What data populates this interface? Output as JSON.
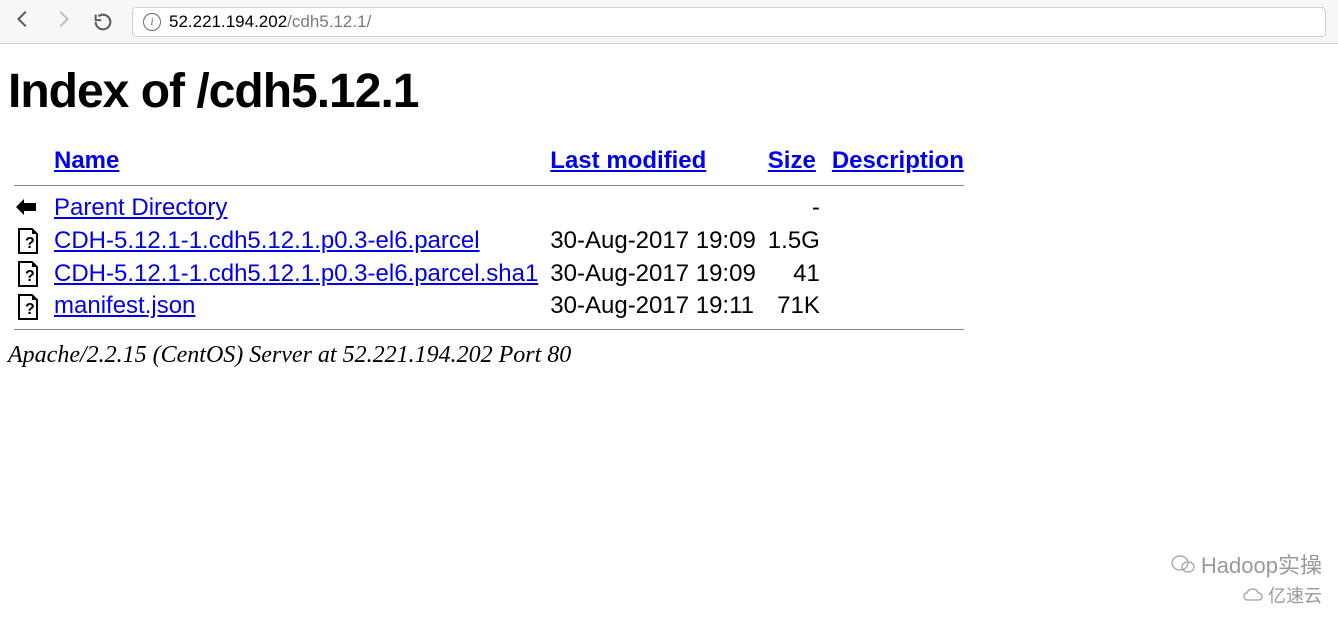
{
  "browser": {
    "url_host": "52.221.194.202",
    "url_path": "/cdh5.12.1/"
  },
  "page": {
    "title": "Index of /cdh5.12.1",
    "columns": {
      "name": "Name",
      "last_modified": "Last modified",
      "size": "Size",
      "description": "Description"
    },
    "rows": [
      {
        "icon": "back",
        "name": "Parent Directory",
        "last_modified": "",
        "size": "-",
        "description": ""
      },
      {
        "icon": "unknown",
        "name": "CDH-5.12.1-1.cdh5.12.1.p0.3-el6.parcel",
        "last_modified": "30-Aug-2017 19:09",
        "size": "1.5G",
        "description": ""
      },
      {
        "icon": "unknown",
        "name": "CDH-5.12.1-1.cdh5.12.1.p0.3-el6.parcel.sha1",
        "last_modified": "30-Aug-2017 19:09",
        "size": "41",
        "description": ""
      },
      {
        "icon": "unknown",
        "name": "manifest.json",
        "last_modified": "30-Aug-2017 19:11",
        "size": "71K",
        "description": ""
      }
    ],
    "footer": "Apache/2.2.15 (CentOS) Server at 52.221.194.202 Port 80"
  },
  "watermark": {
    "top": "Hadoop实操",
    "bottom": "亿速云"
  }
}
